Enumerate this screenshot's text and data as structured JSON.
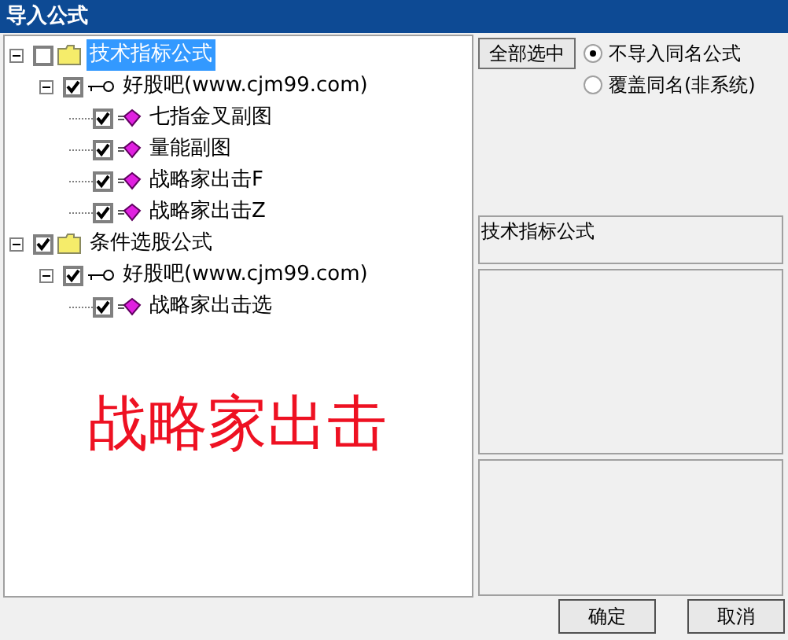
{
  "window": {
    "title": "导入公式"
  },
  "tree": [
    {
      "kind": "folder",
      "label": "技术指标公式",
      "checked": false,
      "selected": true,
      "expanded": true,
      "children": [
        {
          "kind": "group",
          "label": "好股吧(www.cjm99.com)",
          "checked": true,
          "selected": false,
          "expanded": true,
          "children": [
            {
              "kind": "formula",
              "label": "七指金叉副图",
              "checked": true,
              "selected": false
            },
            {
              "kind": "formula",
              "label": "量能副图",
              "checked": true,
              "selected": false
            },
            {
              "kind": "formula",
              "label": "战略家出击F",
              "checked": true,
              "selected": false
            },
            {
              "kind": "formula",
              "label": "战略家出击Z",
              "checked": true,
              "selected": false
            }
          ]
        }
      ]
    },
    {
      "kind": "folder",
      "label": "条件选股公式",
      "checked": true,
      "selected": false,
      "expanded": true,
      "children": [
        {
          "kind": "group",
          "label": "好股吧(www.cjm99.com)",
          "checked": true,
          "selected": false,
          "expanded": true,
          "children": [
            {
              "kind": "formula",
              "label": "战略家出击选",
              "checked": true,
              "selected": false
            }
          ]
        }
      ]
    }
  ],
  "overlay_text": "战略家出击",
  "select_all_button": "全部选中",
  "options": [
    {
      "label": "不导入同名公式",
      "selected": true
    },
    {
      "label": "覆盖同名(非系统)",
      "selected": false
    }
  ],
  "info_box": "技术指标公式",
  "buttons": [
    "确定",
    "取消"
  ]
}
